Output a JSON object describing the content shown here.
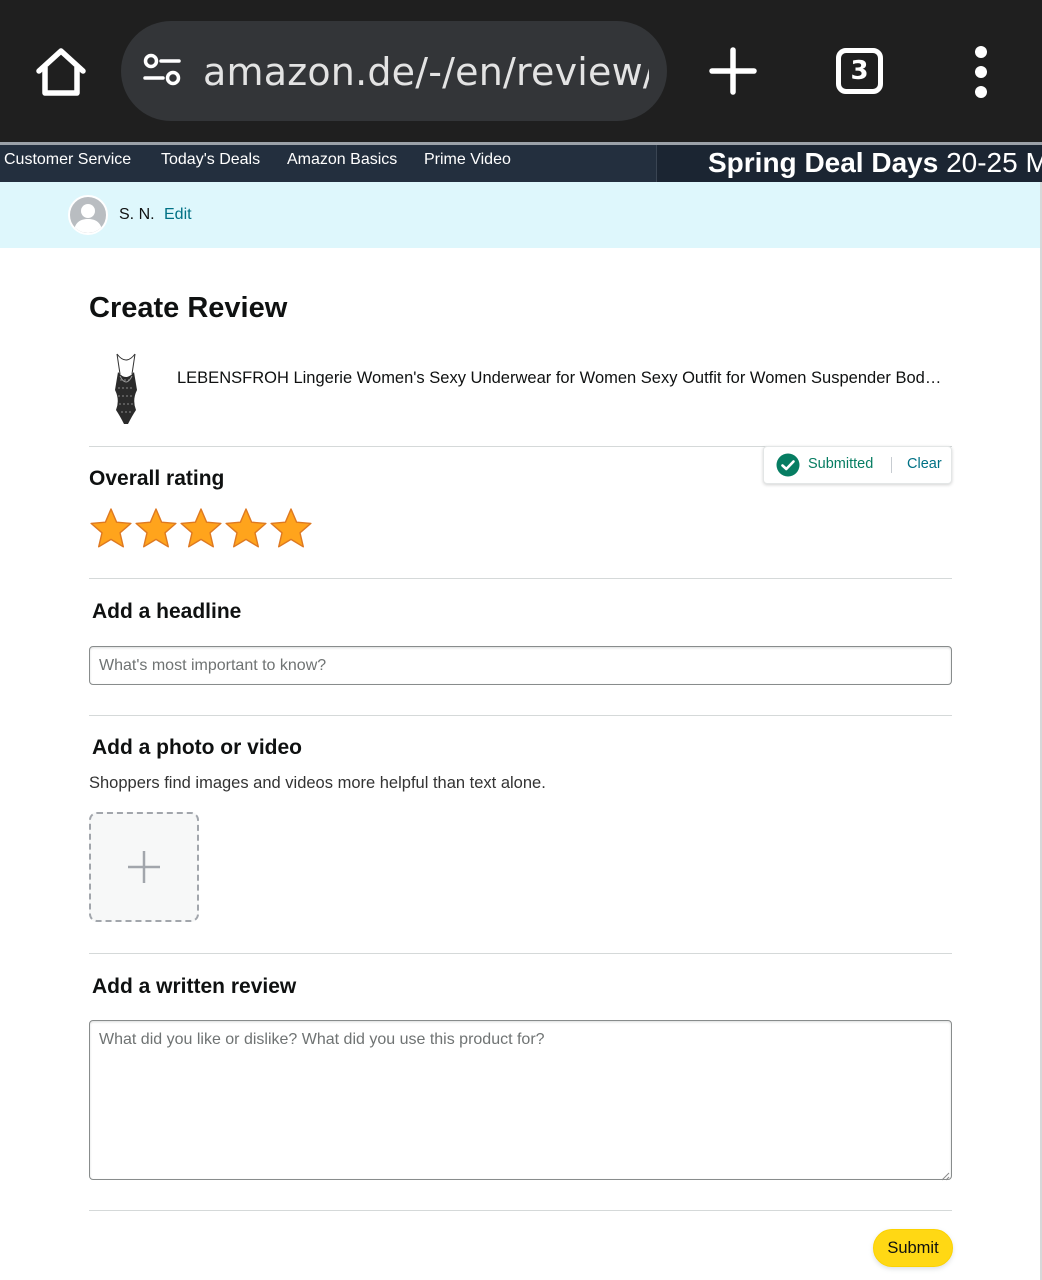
{
  "browser": {
    "url": "amazon.de/-/en/review/r",
    "tab_count": "3",
    "icons": [
      "home-icon",
      "site-settings-icon",
      "plus-icon",
      "tab-switcher-icon",
      "more-vert-icon"
    ]
  },
  "nav": {
    "links": [
      "Customer Service",
      "Today's Deals",
      "Amazon Basics",
      "Prime Video"
    ],
    "promo_bold": "Spring Deal Days",
    "promo_dates": " 20-25 M"
  },
  "profile": {
    "name": "S. N.",
    "edit_label": "Edit"
  },
  "page": {
    "title": "Create Review",
    "product_title": "LEBENSFROH Lingerie Women's Sexy Underwear for Women Sexy Outfit for Women Suspender Bodysuit Lace Lingerie Set"
  },
  "rating": {
    "heading": "Overall rating",
    "stars_selected": 5,
    "stars_total": 5,
    "status_label": "Submitted",
    "clear_label": "Clear"
  },
  "headline": {
    "heading": "Add a headline",
    "placeholder": "What's most important to know?",
    "value": ""
  },
  "media": {
    "heading": "Add a photo or video",
    "helper": "Shoppers find images and videos more helpful than text alone."
  },
  "review": {
    "heading": "Add a written review",
    "placeholder": "What did you like or dislike? What did you use this product for?",
    "value": ""
  },
  "submit_label": "Submit",
  "colors": {
    "browser_bg": "#1f1f1f",
    "nav_bg": "#232f3e",
    "profile_bg": "#def7fc",
    "link": "#007185",
    "success": "#067d62",
    "star": "#ffa41c",
    "button": "#ffd814"
  }
}
